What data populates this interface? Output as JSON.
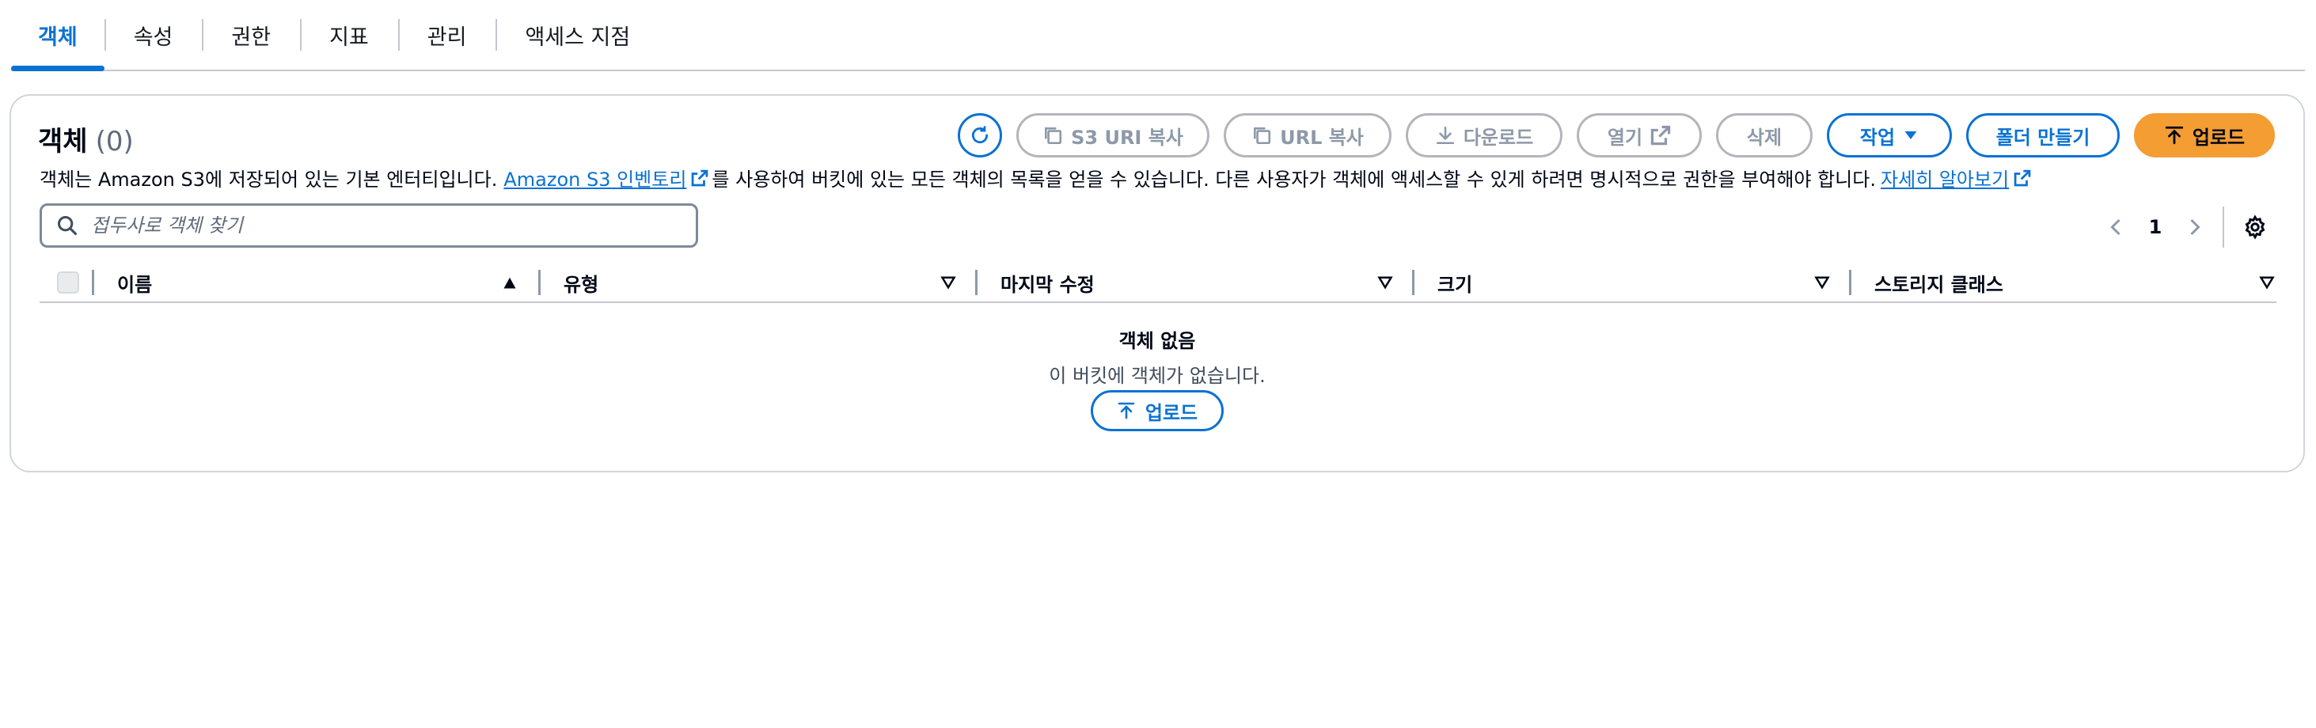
{
  "tabs": [
    {
      "label": "객체",
      "active": true
    },
    {
      "label": "속성",
      "active": false
    },
    {
      "label": "권한",
      "active": false
    },
    {
      "label": "지표",
      "active": false
    },
    {
      "label": "관리",
      "active": false
    },
    {
      "label": "액세스 지점",
      "active": false
    }
  ],
  "panel": {
    "title": "객체",
    "count": "(0)",
    "description_prefix": "객체는 Amazon S3에 저장되어 있는 기본 엔터티입니다.",
    "inventory_link": "Amazon S3 인벤토리",
    "description_middle": "를 사용하여 버킷에 있는 모든 객체의 목록을 얻을 수 있습니다. 다른 사용자가 객체에 액세스할 수 있게 하려면 명시적으로 권한을 부여해야 합니다.",
    "learn_more_link": "자세히 알아보기"
  },
  "toolbar": {
    "copy_s3_uri": "S3 URI 복사",
    "copy_url": "URL 복사",
    "download": "다운로드",
    "open": "열기",
    "delete": "삭제",
    "actions": "작업",
    "create_folder": "폴더 만들기",
    "upload": "업로드"
  },
  "search": {
    "placeholder": "접두사로 객체 찾기"
  },
  "pagination": {
    "current_page": "1"
  },
  "table": {
    "columns": [
      {
        "label": "이름",
        "sort": "ascending"
      },
      {
        "label": "유형",
        "sort": "none"
      },
      {
        "label": "마지막 수정",
        "sort": "none"
      },
      {
        "label": "크기",
        "sort": "none"
      },
      {
        "label": "스토리지 클래스",
        "sort": "none"
      }
    ]
  },
  "empty_state": {
    "title": "객체 없음",
    "description": "이 버킷에 객체가 없습니다.",
    "upload_button": "업로드"
  },
  "colors": {
    "accent": "#0972d3",
    "upload_button": "#f49d33",
    "disabled": "#8d99a8"
  }
}
